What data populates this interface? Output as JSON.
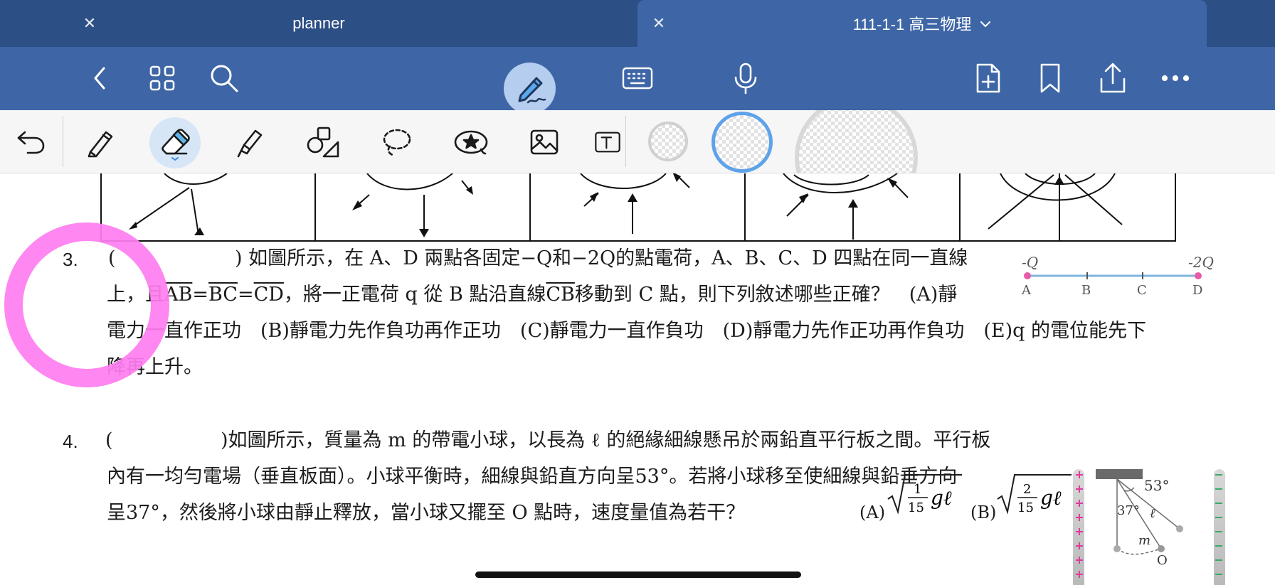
{
  "tabs": [
    {
      "label": "planner",
      "active": false
    },
    {
      "label": "111-1-1 高三物理",
      "active": true
    }
  ],
  "toolbar": {
    "icons": [
      "back-icon",
      "grid-icon",
      "search-icon",
      "pen-mode-icon",
      "keyboard-icon",
      "microphone-icon",
      "add-page-icon",
      "bookmark-icon",
      "share-icon",
      "more-icon"
    ]
  },
  "pen_tools": {
    "icons": [
      "undo-icon",
      "pen-icon",
      "eraser-icon",
      "highlighter-icon",
      "shapes-icon",
      "lasso-icon",
      "sticker-icon",
      "image-icon",
      "text-icon"
    ],
    "selected": "eraser-icon"
  },
  "q3": {
    "number": "3.",
    "paren": "(",
    "line1": ") 如圖所示，在 A、D 兩點各固定−Q和−2Q的點電荷，A、B、C、D 四點在同一直線",
    "line2_a": "上，且",
    "ab": "AB",
    "eq1": "=",
    "bc": "BC",
    "eq2": "=",
    "cd": "CD",
    "line2_b": "，將一正電荷 q 從 B 點沿直線",
    "cb": "CB",
    "line2_c": "移動到 C 點，則下列敘述哪些正確？　(A)靜",
    "line3": "電力一直作正功　(B)靜電力先作負功再作正功　(C)靜電力一直作負功　(D)靜電力先作正功再作負功　(E)q 的電位能先下",
    "line4": "降再上升。",
    "figure": {
      "charge_left": "-Q",
      "charge_right": "-2Q",
      "points": [
        "A",
        "B",
        "C",
        "D"
      ]
    }
  },
  "q4": {
    "number": "4.",
    "paren": "(",
    "line1": ")如圖所示，質量為 m 的帶電小球，以長為 ℓ 的絕緣細線懸吊於兩鉛直平行板之間。平行板",
    "line2": "內有一均勻電場（垂直板面）。小球平衡時，細線與鉛直方向呈53°。若將小球移至使細線與鉛垂方向",
    "line3": "呈37°，然後將小球由靜止釋放，當小球又擺至 O 點時，速度量值為若干？",
    "opt_a": "(A)",
    "opt_a_num": "1",
    "opt_a_den": "15",
    "opt_b": "(B)",
    "opt_b_num": "2",
    "opt_b_den": "15",
    "gl": "gℓ",
    "figure": {
      "angle1": "53°",
      "angle2": "37°",
      "len": "ℓ",
      "mass": "m",
      "origin": "O"
    }
  }
}
